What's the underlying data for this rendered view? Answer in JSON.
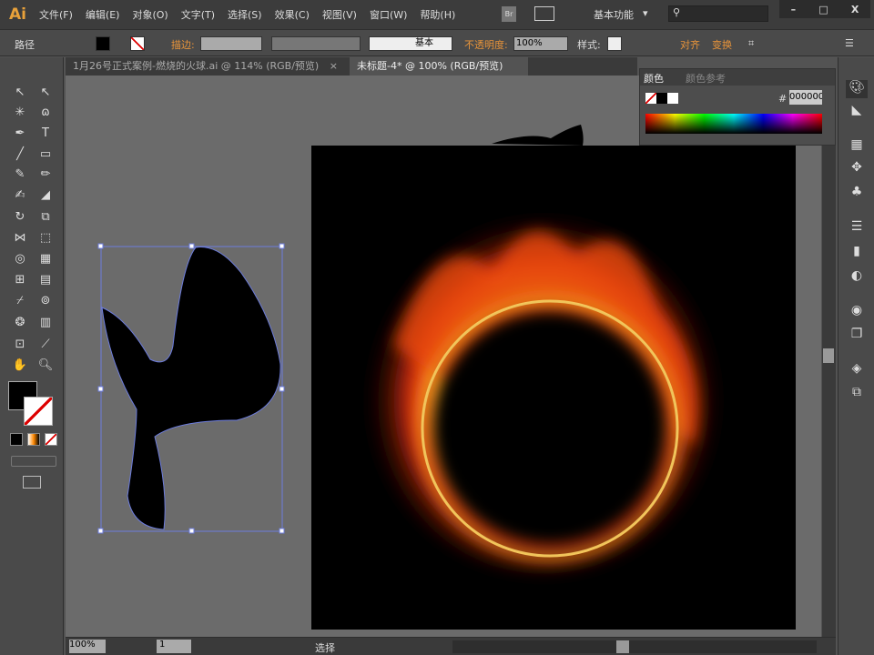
{
  "app": {
    "logo": "Ai",
    "menus": [
      "文件(F)",
      "编辑(E)",
      "对象(O)",
      "文字(T)",
      "选择(S)",
      "效果(C)",
      "视图(V)",
      "窗口(W)",
      "帮助(H)"
    ],
    "bridge": "Br",
    "workspace": "基本功能",
    "workspace_arrow": "▾",
    "window_controls": [
      "–",
      "□",
      "X"
    ]
  },
  "control": {
    "object_type": "路径",
    "stroke_label": "描边:",
    "stroke_style": "基本",
    "opacity_label": "不透明度:",
    "opacity": "100%",
    "style_label": "样式:",
    "align": "对齐",
    "transform": "变换"
  },
  "tabs": [
    {
      "label": "1月26号正式案例-燃烧的火球.ai @ 114% (RGB/预览)",
      "close": "×"
    },
    {
      "label": "未标题-4* @ 100% (RGB/预览)",
      "close": "×",
      "active": true
    }
  ],
  "color_panel": {
    "tabs": [
      "颜色",
      "颜色参考"
    ],
    "hash": "#",
    "hex": "000000"
  },
  "status": {
    "zoom": "100%",
    "page": "1",
    "tool": "选择"
  },
  "colors": {
    "fill": "#000000",
    "stroke": "none",
    "accent": "#e8943a"
  }
}
